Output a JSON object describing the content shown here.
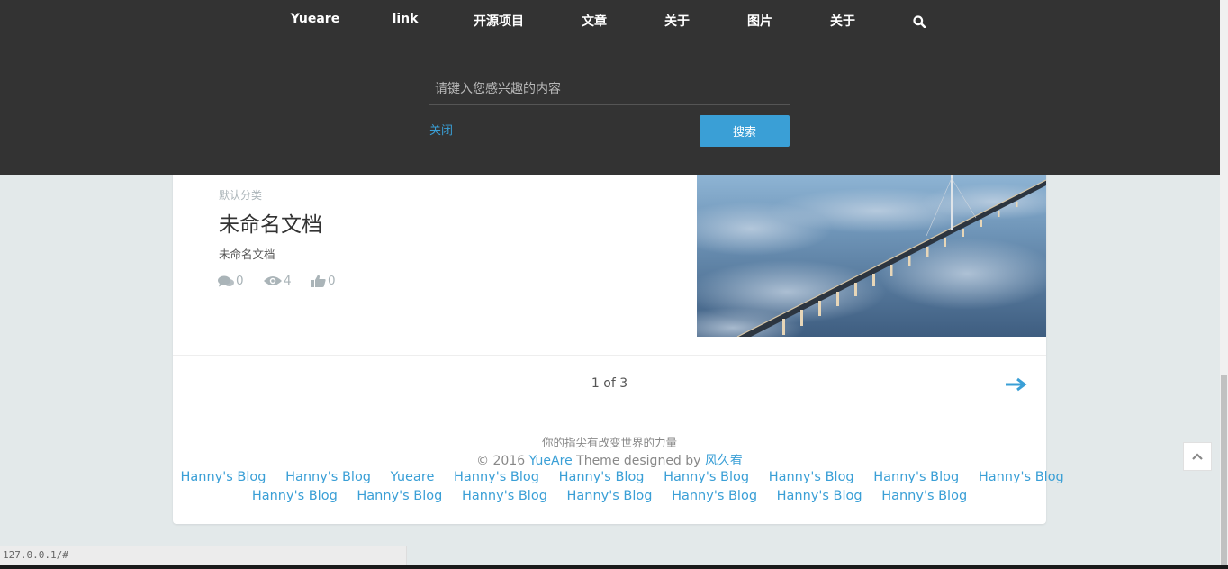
{
  "nav": {
    "items": [
      {
        "label": "Yueare"
      },
      {
        "label": "link"
      },
      {
        "label": "开源项目"
      },
      {
        "label": "文章"
      },
      {
        "label": "关于"
      },
      {
        "label": "图片"
      },
      {
        "label": "关于"
      }
    ],
    "search_icon": "search-icon"
  },
  "search": {
    "placeholder": "请键入您感兴趣的内容",
    "value": "",
    "close_label": "关闭",
    "submit_label": "搜索"
  },
  "post": {
    "category": "默认分类",
    "title": "未命名文档",
    "excerpt": "未命名文档",
    "comments": "0",
    "views": "4",
    "likes": "0",
    "image": "bridge-over-clouds-photo"
  },
  "pagination": {
    "indicator": "1 of 3",
    "next_icon": "arrow-right-icon"
  },
  "footer": {
    "slogan": "你的指尖有改变世界的力量",
    "copy_prefix": "© 2016 ",
    "brand": "YueAre",
    "copy_middle": " Theme designed by ",
    "author": "风久宥",
    "links_row1": [
      "Hanny's Blog",
      "Hanny's Blog",
      "Yueare",
      "Hanny's Blog",
      "Hanny's Blog",
      "Hanny's Blog",
      "Hanny's Blog",
      "Hanny's Blog",
      "Hanny's Blog"
    ],
    "links_row2": [
      "Hanny's Blog",
      "Hanny's Blog",
      "Hanny's Blog",
      "Hanny's Blog",
      "Hanny's Blog",
      "Hanny's Blog",
      "Hanny's Blog"
    ]
  },
  "status_bar": {
    "url": "127.0.0.1/#"
  },
  "colors": {
    "accent": "#3a9fd6",
    "nav_bg": "#333333",
    "page_bg": "#e3e9ea"
  }
}
